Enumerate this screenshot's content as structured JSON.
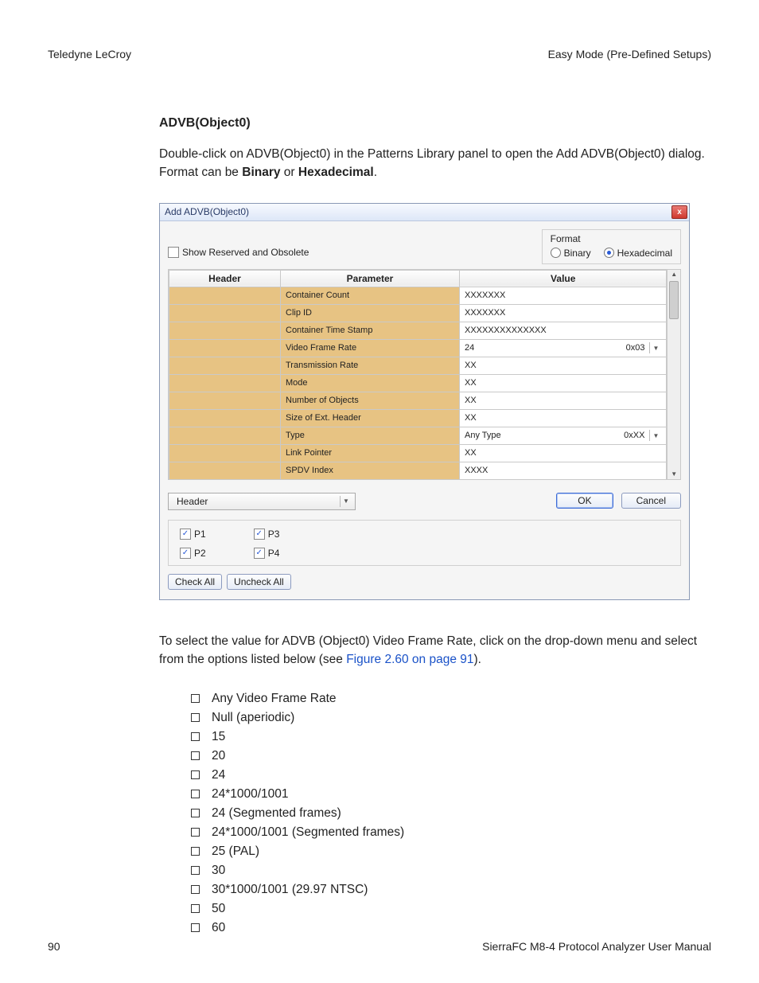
{
  "header": {
    "left": "Teledyne  LeCroy",
    "right": "Easy Mode (Pre-Defined Setups)"
  },
  "section_heading": "ADVB(Object0)",
  "body_before": "Double-click on ADVB(Object0) in the Patterns Library panel to open the Add ADVB(Object0) dialog. Format can be ",
  "body_bold1": "Binary",
  "body_middle": " or ",
  "body_bold2": "Hexadecimal",
  "body_end": ".",
  "dialog": {
    "title": "Add ADVB(Object0)",
    "close": "x",
    "show_reserved": "Show Reserved and Obsolete",
    "format": {
      "legend": "Format",
      "opt1": "Binary",
      "opt2": "Hexadecimal"
    },
    "cols": {
      "h": "Header",
      "p": "Parameter",
      "v": "Value"
    },
    "rows": [
      {
        "p": "Container Count",
        "v": "XXXXXXX",
        "hex": "",
        "drop": false
      },
      {
        "p": "Clip ID",
        "v": "XXXXXXX",
        "hex": "",
        "drop": false
      },
      {
        "p": "Container Time Stamp",
        "v": "XXXXXXXXXXXXXX",
        "hex": "",
        "drop": false
      },
      {
        "p": "Video Frame Rate",
        "v": "24",
        "hex": "0x03",
        "drop": true
      },
      {
        "p": "Transmission Rate",
        "v": "XX",
        "hex": "",
        "drop": false
      },
      {
        "p": "Mode",
        "v": "XX",
        "hex": "",
        "drop": false
      },
      {
        "p": "Number of Objects",
        "v": "XX",
        "hex": "",
        "drop": false
      },
      {
        "p": "Size of Ext. Header",
        "v": "XX",
        "hex": "",
        "drop": false
      },
      {
        "p": "Type",
        "v": "Any Type",
        "hex": "0xXX",
        "drop": true
      },
      {
        "p": "Link Pointer",
        "v": "XX",
        "hex": "",
        "drop": false
      },
      {
        "p": "SPDV Index",
        "v": "XXXX",
        "hex": "",
        "drop": false
      }
    ],
    "config_select": "Header",
    "ok": "OK",
    "cancel": "Cancel",
    "ports": {
      "p1": "P1",
      "p2": "P2",
      "p3": "P3",
      "p4": "P4"
    },
    "check_all": "Check All",
    "uncheck_all": "Uncheck All"
  },
  "body2_a": "To select the value for ADVB (Object0) Video Frame Rate, click on the drop-down menu and select from the options listed below (see ",
  "body2_link": "Figure 2.60 on page 91",
  "body2_b": ").",
  "options": [
    "Any Video Frame Rate",
    "Null (aperiodic)",
    "15",
    "20",
    "24",
    "24*1000/1001",
    "24 (Segmented frames)",
    "24*1000/1001 (Segmented frames)",
    "25 (PAL)",
    "30",
    "30*1000/1001 (29.97 NTSC)",
    "50",
    "60"
  ],
  "footer": {
    "page": "90",
    "manual": "SierraFC M8-4 Protocol Analyzer User Manual"
  }
}
